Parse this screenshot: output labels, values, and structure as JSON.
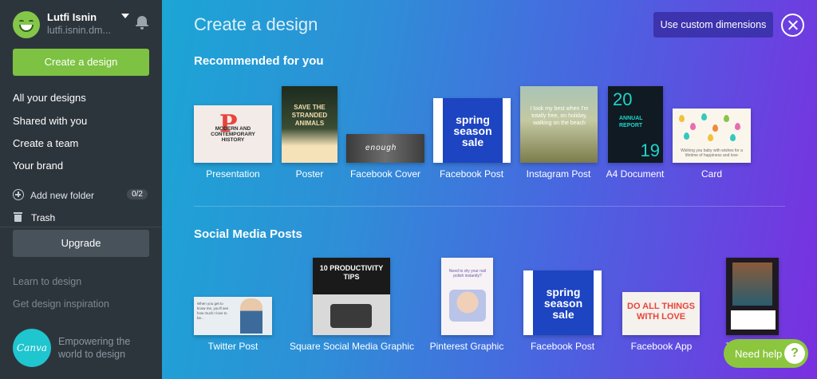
{
  "user": {
    "name": "Lutfi Isnin",
    "email": "lutfi.isnin.dm..."
  },
  "sidebar": {
    "create_label": "Create a design",
    "nav": [
      {
        "label": "All your designs"
      },
      {
        "label": "Shared with you"
      },
      {
        "label": "Create a team"
      },
      {
        "label": "Your brand"
      }
    ],
    "add_folder": {
      "label": "Add new folder",
      "count": "0/2"
    },
    "trash_label": "Trash",
    "upgrade_label": "Upgrade",
    "links": [
      {
        "label": "Learn to design"
      },
      {
        "label": "Get design inspiration"
      }
    ],
    "logo_text": "Canva",
    "tagline": "Empowering the world to design"
  },
  "main": {
    "title": "Create a design",
    "custom_dimensions_label": "Use custom dimensions",
    "sections": [
      {
        "title": "Recommended for you",
        "items": [
          {
            "label": "Presentation",
            "thumb_text": "MODERN AND CONTEMPORARY HISTORY",
            "thumb_big": "P"
          },
          {
            "label": "Poster",
            "thumb_text": "SAVE THE STRANDED ANIMALS"
          },
          {
            "label": "Facebook Cover",
            "thumb_text": "enough"
          },
          {
            "label": "Facebook Post",
            "thumb_text": "spring season sale"
          },
          {
            "label": "Instagram Post",
            "thumb_text": "I look my best when I'm totally free, on holiday, walking on the beach"
          },
          {
            "label": "A4 Document",
            "thumb_top": "20",
            "thumb_mid": "ANNUAL REPORT",
            "thumb_bottom": "19"
          },
          {
            "label": "Card",
            "thumb_text": "Wishing you baby with wishes for a lifetime of happiness and love"
          }
        ]
      },
      {
        "title": "Social Media Posts",
        "items": [
          {
            "label": "Twitter Post",
            "thumb_text": "When you get to know me, you'll see how much I love to be..."
          },
          {
            "label": "Square Social Media Graphic",
            "thumb_text": "10 PRODUCTIVITY TIPS"
          },
          {
            "label": "Pinterest Graphic",
            "thumb_text": "Need to dry your nail polish instantly?"
          },
          {
            "label": "Facebook Post",
            "thumb_text": "spring season sale"
          },
          {
            "label": "Facebook App",
            "thumb_text": "DO ALL THINGS WITH LOVE"
          },
          {
            "label": "T"
          }
        ]
      }
    ]
  },
  "help": {
    "label": "Need help",
    "icon": "?"
  },
  "colors": {
    "accent_green": "#7dc242",
    "sidebar_bg": "#2d353c",
    "custom_btn": "#3d33ae",
    "gradient_start": "#1ba6d5",
    "gradient_end": "#7a2fe0"
  }
}
